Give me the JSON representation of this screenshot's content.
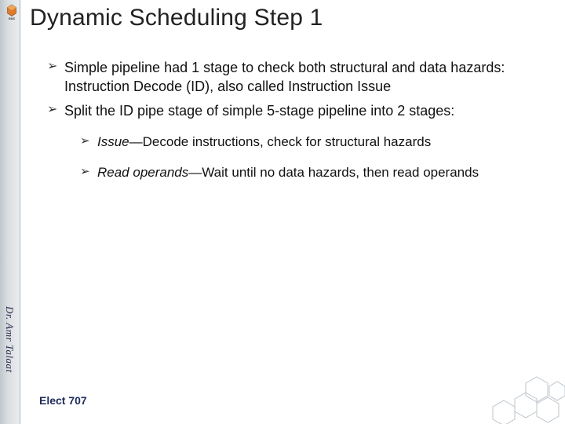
{
  "title": "Dynamic Scheduling Step 1",
  "bullets": {
    "b1": "Simple pipeline had 1 stage to check both structural and data hazards: Instruction Decode (ID), also called Instruction Issue",
    "b2": "Split the ID pipe stage of simple 5-stage pipeline into 2 stages:",
    "sub1_em": "Issue",
    "sub1_rest": "—Decode instructions, check for structural hazards",
    "sub2_em": "Read operands",
    "sub2_rest": "—Wait until no data hazards, then read operands"
  },
  "author": "Dr. Amr Talaat",
  "course": "Elect 707",
  "icons": {
    "bullet_mark": "➢",
    "logo_name": "guc-logo",
    "corner_name": "hex-pattern"
  }
}
